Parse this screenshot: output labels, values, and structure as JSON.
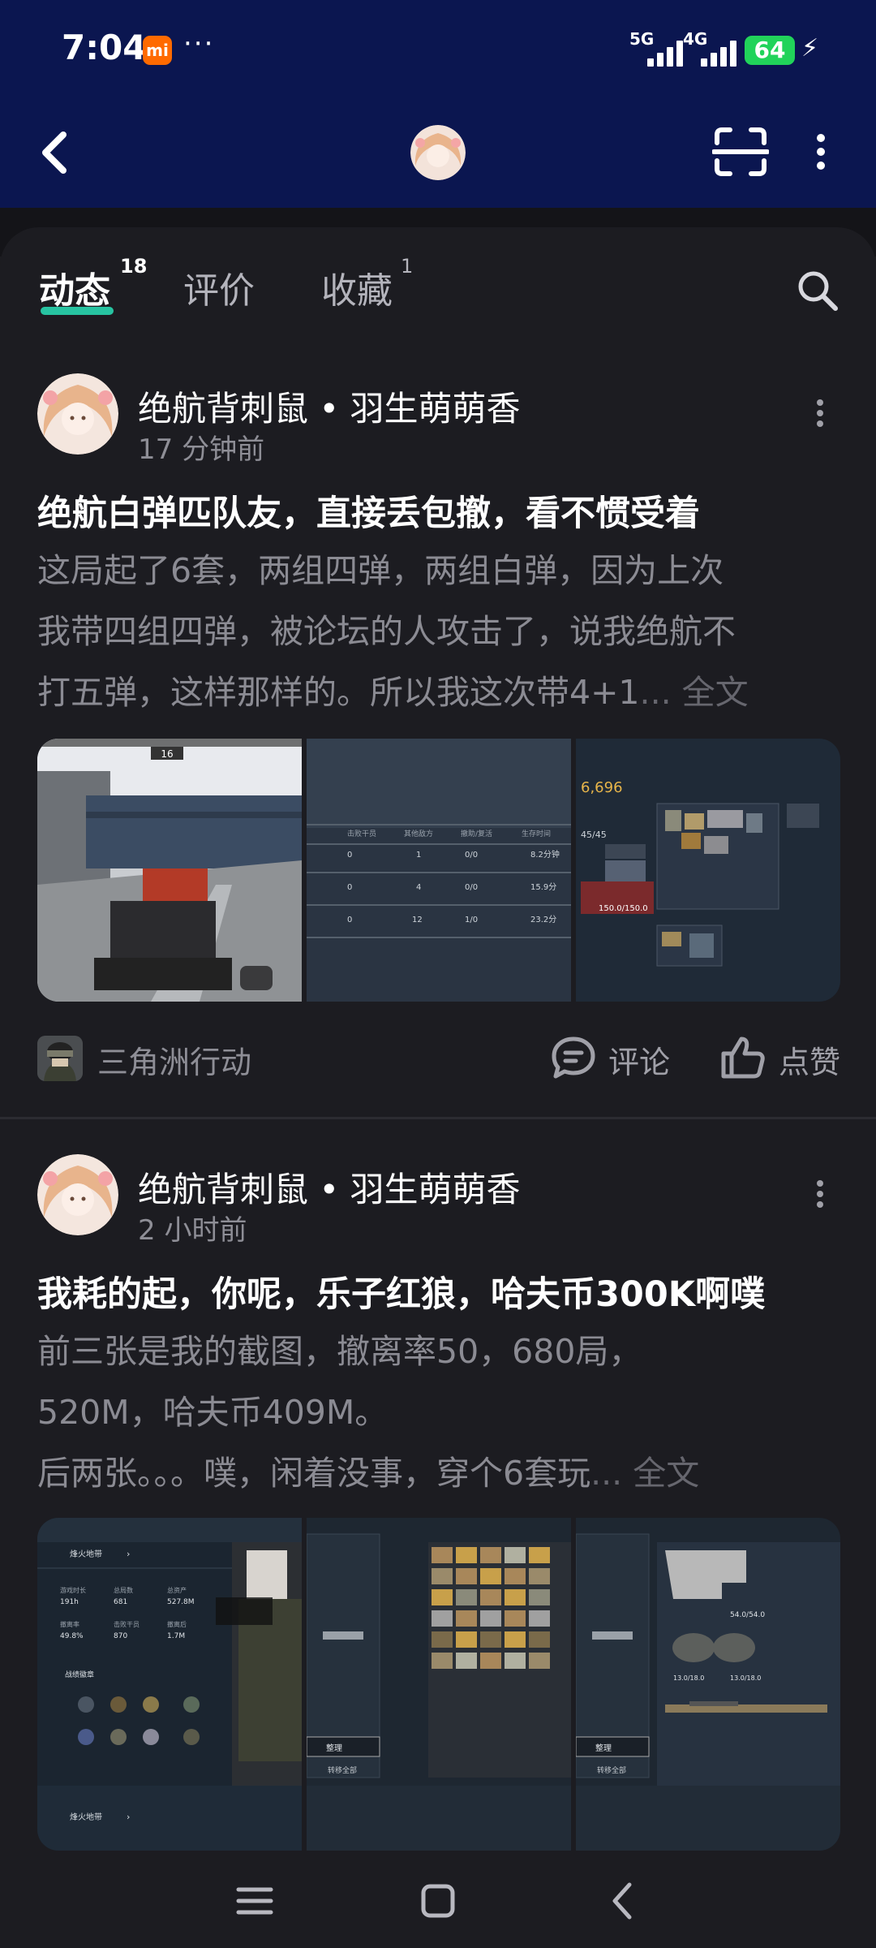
{
  "status_bar": {
    "time": "7:04",
    "mi_badge": "mi",
    "dots": "···",
    "signal_1_label": "5G",
    "signal_2_label": "4G",
    "battery": "64",
    "colors": {
      "battery": "#21d35a",
      "band": "#0b1650",
      "mi": "#ff6a00"
    }
  },
  "header": {
    "back_icon": "chevron-left-icon",
    "scan_icon": "scan-icon",
    "menu_icon": "vertical-dots-icon"
  },
  "tabs": [
    {
      "label": "动态",
      "count": "18",
      "active": true
    },
    {
      "label": "评价",
      "count": "",
      "active": false
    },
    {
      "label": "收藏",
      "count": "1",
      "active": false
    }
  ],
  "accent_color": "#27c3a1",
  "posts": [
    {
      "author": "绝航背刺鼠 • 羽生萌萌香",
      "time": "17 分钟前",
      "title": "绝航白弹匹队友，直接丢包撤，看不惯受着",
      "body_lines": [
        "这局起了6套，两组四弹，两组白弹，因为上次",
        "我带四组四弹，被论坛的人攻击了，说我绝航不",
        "打五弹，这样那样的。所以我这次带4+1"
      ],
      "more_label": "... 全文",
      "images": [
        {
          "kind": "fps-scene",
          "label": "16"
        },
        {
          "kind": "stats-table",
          "rows": [
            [
              "0",
              "1",
              "0/0",
              "8.2分钟"
            ],
            [
              "0",
              "4",
              "0/0",
              "15.9分"
            ],
            [
              "0",
              "12",
              "1/0",
              "23.2分"
            ]
          ],
          "header": [
            "击败干员",
            "其他敌方",
            "撤助/复活",
            "生存时间"
          ]
        },
        {
          "kind": "loadout",
          "label": "6,696",
          "sub": "45/45",
          "hp": "150.0/150.0"
        }
      ],
      "game": "三角洲行动",
      "comment_label": "评论",
      "like_label": "点赞"
    },
    {
      "author": "绝航背刺鼠 • 羽生萌萌香",
      "time": "2 小时前",
      "title": "我耗的起，你呢，乐子红狼，哈夫币300K啊噗",
      "body_lines": [
        "前三张是我的截图，撤离率50，680局，",
        "520M，哈夫币409M。",
        "后两张。。。噗，闲着没事，穿个6套玩"
      ],
      "more_label": "... 全文",
      "images": [
        {
          "kind": "profile",
          "title": "烽火地带",
          "stats": [
            [
              "游戏时长",
              "总局数",
              "总资产"
            ],
            [
              "191h",
              "681",
              "527.8M"
            ],
            [
              "撤离率",
              "击败干员",
              "撤离后"
            ],
            [
              "49.8%",
              "870",
              "1.7M"
            ]
          ],
          "section": "战绩徽章"
        },
        {
          "kind": "inventory",
          "btn1": "整理",
          "btn2": "转移全部"
        },
        {
          "kind": "gear",
          "btn1": "整理",
          "btn2": "转移全部",
          "v1": "54.0/54.0",
          "v2": "13.0/18.0",
          "v3": "13.0/18.0"
        }
      ],
      "game": "",
      "comment_label": "",
      "like_label": ""
    }
  ],
  "navbar": {
    "icons": [
      "menu-icon",
      "home-square-icon",
      "back-icon"
    ]
  }
}
